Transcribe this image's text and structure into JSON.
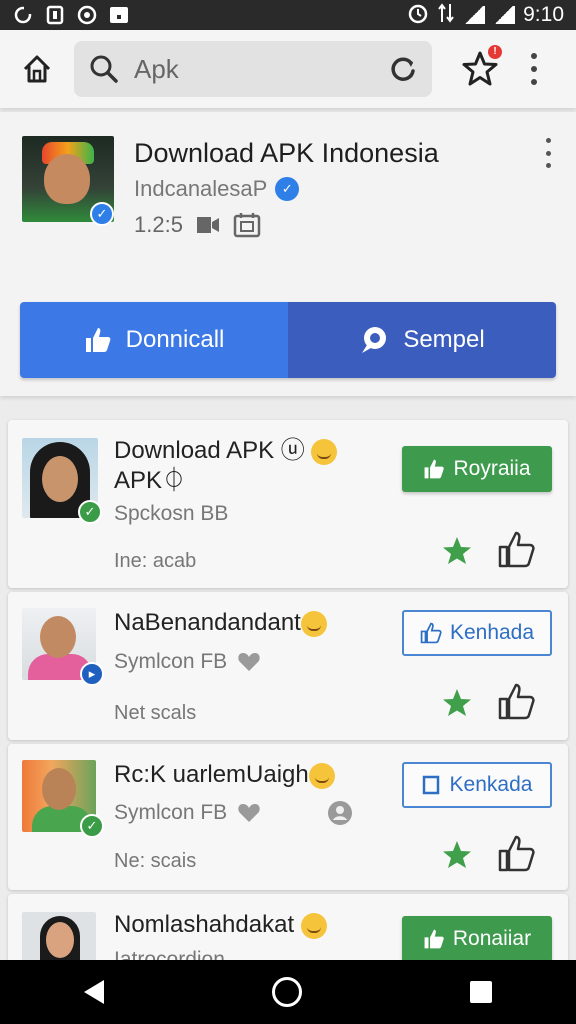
{
  "status_bar": {
    "time": "9:10",
    "left_icons": [
      "sync-icon",
      "sim-icon",
      "record-icon",
      "notification-icon"
    ]
  },
  "top_bar": {
    "search_value": "Apk",
    "badge": "!"
  },
  "header": {
    "title": "Download APK Indonesia",
    "subtitle": "IndcanalesaP",
    "meta_count": "1.2:5",
    "primary_button": "Donnicall",
    "secondary_button": "Sempel"
  },
  "items": [
    {
      "title_line1": "Download APK ⓤ",
      "title_line2": "APK⏀",
      "subtitle": "Spckosn BB",
      "note": "Ine: acab",
      "action": "Royraiia",
      "action_style": "solid"
    },
    {
      "title_line1": "NaBenandandant",
      "title_line2": "",
      "subtitle": "Symlcon FB",
      "note": "Net scals",
      "action": "Kenhada",
      "action_style": "outline"
    },
    {
      "title_line1": "Rc:K uarlemUaigh",
      "title_line2": "",
      "subtitle": "Symlcon FB",
      "note": "Ne: scais",
      "action": "Kenkada",
      "action_style": "outline"
    },
    {
      "title_line1": "Nomlashahdakat",
      "title_line2": "",
      "subtitle": "Iatrocordion",
      "note": "",
      "action": "Ronaiiar",
      "action_style": "solid"
    }
  ],
  "colors": {
    "accent_blue": "#3d79e6",
    "accent_indigo": "#3b5dbd",
    "accent_green": "#3e9b4d",
    "star_green": "#3f9f4a"
  }
}
